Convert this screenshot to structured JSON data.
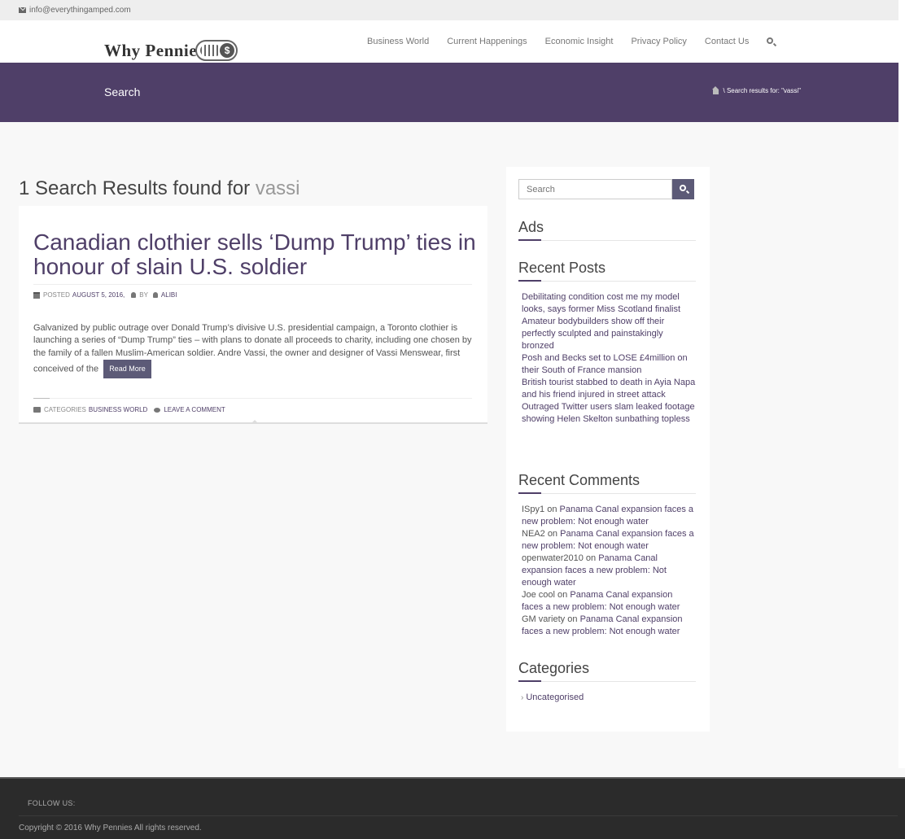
{
  "topbar": {
    "email": "info@everythingamped.com"
  },
  "header": {
    "logo_text": "Why Pennie",
    "logo_symbol": "$",
    "nav": [
      "Business World",
      "Current Happenings",
      "Economic Insight",
      "Privacy Policy",
      "Contact Us"
    ]
  },
  "banner": {
    "title": "Search",
    "breadcrumb": "\\ Search results for: \"vassi\""
  },
  "results": {
    "prefix": "1 Search Results found for",
    "term": "vassi"
  },
  "post": {
    "title": "Canadian clothier sells ‘Dump Trump’ ties in honour of slain U.S. soldier",
    "posted_label": "POSTED",
    "date": "AUGUST 5, 2016,",
    "by_label": "BY",
    "author": "ALIBI",
    "excerpt": "Galvanized by public outrage over Donald Trump’s divisive U.S. presidential campaign, a Toronto clothier is launching a series of “Dump Trump” ties – with plans to donate all proceeds to charity, including one chosen by the family of a fallen Muslim-American soldier. Andre Vassi, the owner and designer of Vassi Menswear, first conceived of the",
    "read_more": "Read More",
    "categories_label": "CATEGORIES",
    "category": "BUSINESS WORLD",
    "leave_comment": "LEAVE A COMMENT"
  },
  "sidebar": {
    "search_placeholder": "Search",
    "ads_title": "Ads",
    "recent_posts_title": "Recent Posts",
    "recent_posts": [
      "Debilitating condition cost me my model looks, says former Miss Scotland finalist",
      "Amateur bodybuilders show off their perfectly sculpted and painstakingly bronzed",
      "Posh and Becks set to LOSE £4million on their South of France mansion",
      "British tourist stabbed to death in Ayia Napa and his friend injured in street attack",
      "Outraged Twitter users slam leaked footage showing Helen Skelton sunbathing topless"
    ],
    "recent_comments_title": "Recent Comments",
    "recent_comments": [
      {
        "author": "ISpy1",
        "on": "on",
        "post": "Panama Canal expansion faces a new problem: Not enough water"
      },
      {
        "author": "NEA2",
        "on": "on",
        "post": "Panama Canal expansion faces a new problem: Not enough water"
      },
      {
        "author": "openwater2010",
        "on": "on",
        "post": "Panama Canal expansion faces a new problem: Not enough water"
      },
      {
        "author": "Joe cool",
        "on": "on",
        "post": "Panama Canal expansion faces a new problem: Not enough water"
      },
      {
        "author": "GM variety",
        "on": "on",
        "post": "Panama Canal expansion faces a new problem: Not enough water"
      }
    ],
    "categories_title": "Categories",
    "categories": [
      "Uncategorised"
    ]
  },
  "footer": {
    "follow": "FOLLOW US:",
    "copyright": "Copyright © 2016 Why Pennies All rights reserved."
  },
  "colors": {
    "accent": "#4f3f68",
    "button": "#5c5a77",
    "footer": "#2b2b2b"
  }
}
